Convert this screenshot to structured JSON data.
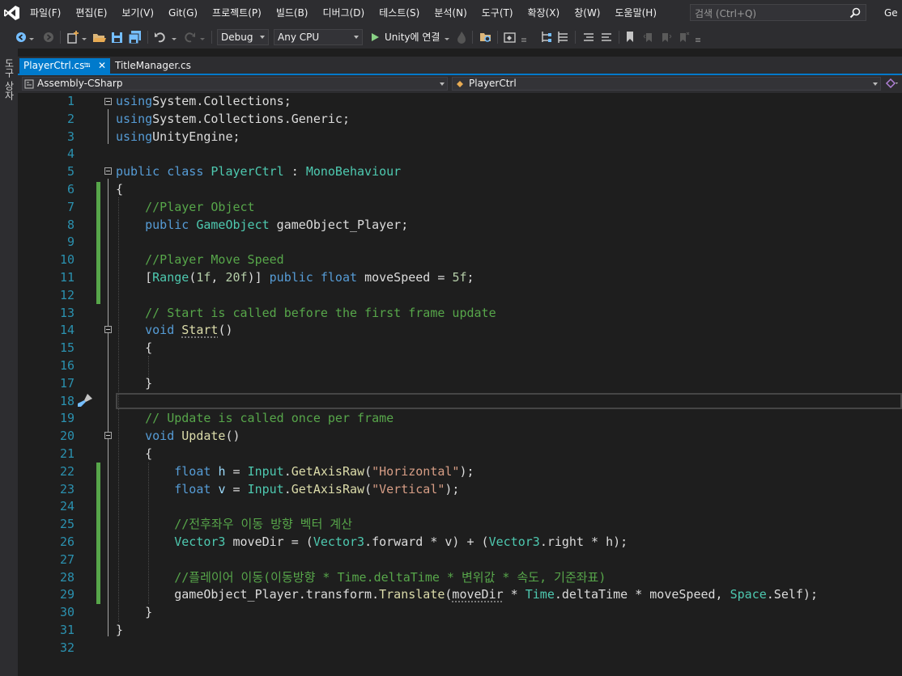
{
  "menu": {
    "items": [
      "파일(F)",
      "편집(E)",
      "보기(V)",
      "Git(G)",
      "프로젝트(P)",
      "빌드(B)",
      "디버그(D)",
      "테스트(S)",
      "분석(N)",
      "도구(T)",
      "확장(X)",
      "창(W)",
      "도움말(H)"
    ],
    "search_placeholder": "검색 (Ctrl+Q)",
    "overflow_text": "Ge"
  },
  "toolbar": {
    "config": "Debug",
    "platform": "Any CPU",
    "run_label": "Unity에 연결"
  },
  "side_strip": {
    "label": "도구 상자"
  },
  "tabs": [
    {
      "label": "PlayerCtrl.cs",
      "active": true
    },
    {
      "label": "TitleManager.cs",
      "active": false
    }
  ],
  "nav": {
    "project": "Assembly-CSharp",
    "type": "PlayerCtrl"
  },
  "colors": {
    "accent": "#007acc",
    "keyword": "#569cd6",
    "type": "#4ec9b0",
    "comment": "#57a64a",
    "string": "#d69d85",
    "number": "#b5cea8",
    "method": "#dcdcaa",
    "line_number": "#2b91af"
  },
  "editor": {
    "lines": [
      [
        [
          "kw",
          "using"
        ],
        [
          "",
          "System.Collections;"
        ]
      ],
      [
        [
          "kw",
          "using"
        ],
        [
          "",
          "System.Collections.Generic;"
        ]
      ],
      [
        [
          "kw",
          "using"
        ],
        [
          "",
          "UnityEngine;"
        ]
      ],
      [],
      [
        [
          "kw",
          "public class "
        ],
        [
          "ty",
          "PlayerCtrl"
        ],
        [
          "",
          " : "
        ],
        [
          "ty",
          "MonoBehaviour"
        ]
      ],
      [
        [
          "",
          "{"
        ]
      ],
      [
        [
          "",
          "    "
        ],
        [
          "cmt",
          "//Player Object"
        ]
      ],
      [
        [
          "",
          "    "
        ],
        [
          "kw",
          "public "
        ],
        [
          "ty",
          "GameObject"
        ],
        [
          "",
          " gameObject_Player;"
        ]
      ],
      [],
      [
        [
          "",
          "    "
        ],
        [
          "cmt",
          "//Player Move Speed"
        ]
      ],
      [
        [
          "",
          "    ["
        ],
        [
          "ty",
          "Range"
        ],
        [
          "",
          "("
        ],
        [
          "num",
          "1f"
        ],
        [
          "",
          ", "
        ],
        [
          "num",
          "20f"
        ],
        [
          "",
          ")] "
        ],
        [
          "kw",
          "public float "
        ],
        [
          "",
          "moveSpeed = "
        ],
        [
          "num",
          "5f"
        ],
        [
          "",
          ";"
        ]
      ],
      [],
      [
        [
          "",
          "    "
        ],
        [
          "cmt",
          "// Start is called before the first frame update"
        ]
      ],
      [
        [
          "",
          "    "
        ],
        [
          "kw",
          "void "
        ],
        [
          "mth dots",
          "Start"
        ],
        [
          "",
          "()"
        ]
      ],
      [
        [
          "",
          "    {"
        ]
      ],
      [],
      [
        [
          "",
          "    }"
        ]
      ],
      [],
      [
        [
          "",
          "    "
        ],
        [
          "cmt",
          "// Update is called once per frame"
        ]
      ],
      [
        [
          "",
          "    "
        ],
        [
          "kw",
          "void "
        ],
        [
          "mth",
          "Update"
        ],
        [
          "",
          "()"
        ]
      ],
      [
        [
          "",
          "    {"
        ]
      ],
      [
        [
          "",
          "        "
        ],
        [
          "kw",
          "float "
        ],
        [
          "var",
          "h"
        ],
        [
          "",
          " = "
        ],
        [
          "ty",
          "Input"
        ],
        [
          "",
          "."
        ],
        [
          "mth",
          "GetAxisRaw"
        ],
        [
          "",
          "("
        ],
        [
          "str",
          "\"Horizontal\""
        ],
        [
          "",
          ");"
        ]
      ],
      [
        [
          "",
          "        "
        ],
        [
          "kw",
          "float "
        ],
        [
          "var",
          "v"
        ],
        [
          "",
          " = "
        ],
        [
          "ty",
          "Input"
        ],
        [
          "",
          "."
        ],
        [
          "mth",
          "GetAxisRaw"
        ],
        [
          "",
          "("
        ],
        [
          "str",
          "\"Vertical\""
        ],
        [
          "",
          ");"
        ]
      ],
      [],
      [
        [
          "",
          "        "
        ],
        [
          "cmt",
          "//전후좌우 이동 방향 벡터 계산"
        ]
      ],
      [
        [
          "",
          "        "
        ],
        [
          "ty",
          "Vector3"
        ],
        [
          "",
          " moveDir = ("
        ],
        [
          "ty",
          "Vector3"
        ],
        [
          "",
          ".forward * v) + ("
        ],
        [
          "ty",
          "Vector3"
        ],
        [
          "",
          ".right * h);"
        ]
      ],
      [],
      [
        [
          "",
          "        "
        ],
        [
          "cmt",
          "//플레이어 이동(이동방향 * Time.deltaTime * 변위값 * 속도, 기준좌표)"
        ]
      ],
      [
        [
          "",
          "        gameObject_Player.transform."
        ],
        [
          "mth",
          "Translate"
        ],
        [
          "",
          "("
        ],
        [
          "dots",
          "moveDir"
        ],
        [
          "",
          " * "
        ],
        [
          "ty",
          "Time"
        ],
        [
          "",
          ".deltaTime * moveSpeed, "
        ],
        [
          "ty",
          "Space"
        ],
        [
          "",
          ".Self);"
        ]
      ],
      [
        [
          "",
          "    }"
        ]
      ],
      [
        [
          "",
          "}"
        ]
      ],
      []
    ]
  }
}
